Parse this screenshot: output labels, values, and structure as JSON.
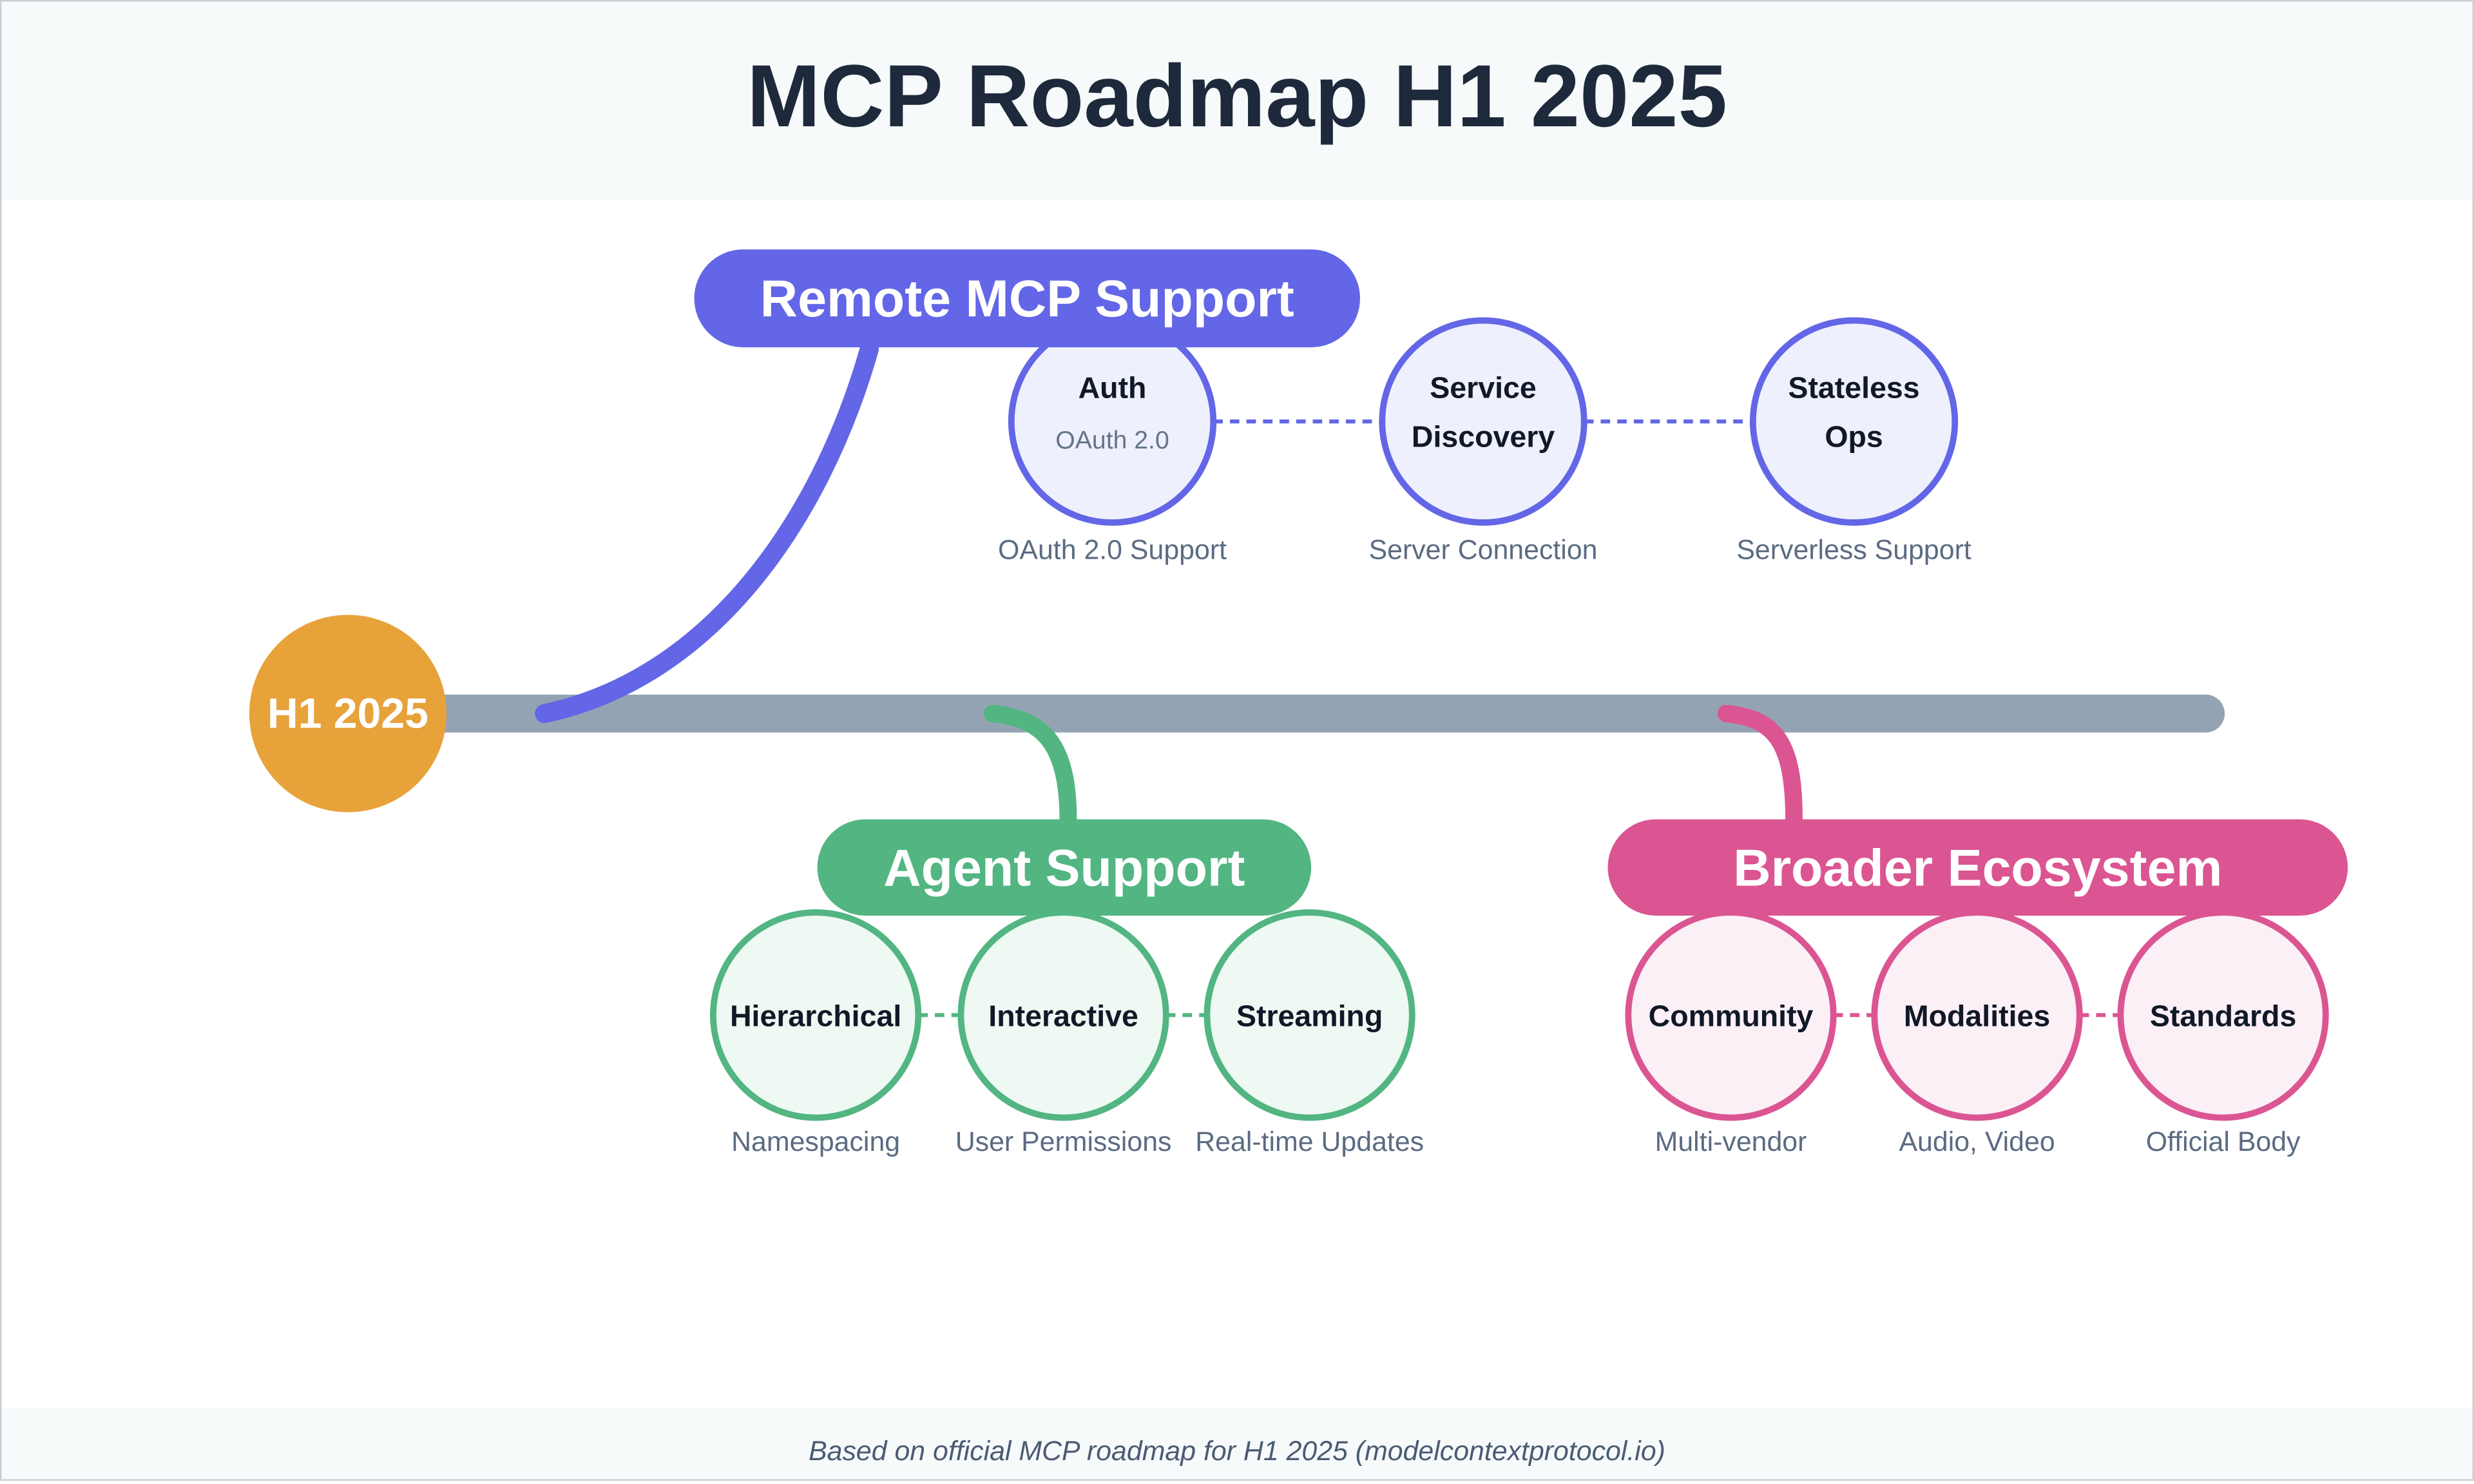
{
  "header": {
    "title": "MCP Roadmap H1 2025"
  },
  "origin": {
    "label": "H1 2025",
    "color": "#e8a23a"
  },
  "timeline": {
    "color": "#94a3b4"
  },
  "branches": [
    {
      "id": "remote",
      "label": "Remote MCP Support",
      "color": "#6366e6",
      "node_fill": "#eef1fd",
      "connector": "dashed",
      "position": "above",
      "nodes": [
        {
          "title_lines": [
            "Auth"
          ],
          "subtitle": "OAuth 2.0",
          "caption": "OAuth 2.0 Support"
        },
        {
          "title_lines": [
            "Service",
            "Discovery"
          ],
          "subtitle": "",
          "caption": "Server Connection"
        },
        {
          "title_lines": [
            "Stateless",
            "Ops"
          ],
          "subtitle": "",
          "caption": "Serverless Support"
        }
      ]
    },
    {
      "id": "agent",
      "label": "Agent Support",
      "color": "#52b582",
      "node_fill": "#edf9f2",
      "connector": "dashed",
      "position": "below",
      "nodes": [
        {
          "title_lines": [
            "Hierarchical"
          ],
          "subtitle": "",
          "caption": "Namespacing"
        },
        {
          "title_lines": [
            "Interactive"
          ],
          "subtitle": "",
          "caption": "User Permissions"
        },
        {
          "title_lines": [
            "Streaming"
          ],
          "subtitle": "",
          "caption": "Real-time Updates"
        }
      ]
    },
    {
      "id": "ecosystem",
      "label": "Broader Ecosystem",
      "color": "#db5592",
      "node_fill": "#fbf0f6",
      "connector": "dashed",
      "position": "below",
      "nodes": [
        {
          "title_lines": [
            "Community"
          ],
          "subtitle": "",
          "caption": "Multi-vendor"
        },
        {
          "title_lines": [
            "Modalities"
          ],
          "subtitle": "",
          "caption": "Audio, Video"
        },
        {
          "title_lines": [
            "Standards"
          ],
          "subtitle": "",
          "caption": "Official Body"
        }
      ]
    }
  ],
  "footer": {
    "text": "Based on official MCP roadmap for H1 2025 (modelcontextprotocol.io)"
  }
}
